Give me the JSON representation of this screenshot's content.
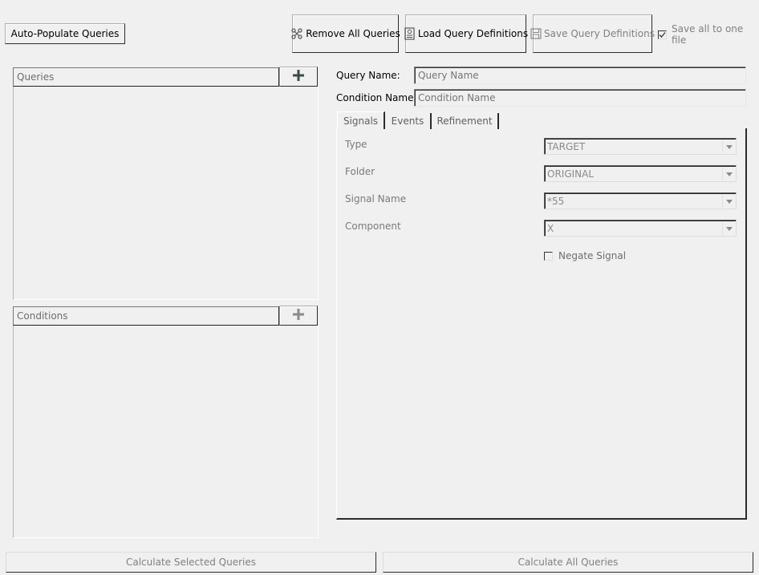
{
  "toolbar": {
    "auto_populate": "Auto-Populate Queries",
    "remove_all": "Remove All Queries",
    "load_defs": "Load Query Definitions",
    "save_defs": "Save Query Definitions",
    "save_all_one_file": "Save all to one file",
    "save_all_checked": true
  },
  "queries_panel": {
    "header": "Queries"
  },
  "conditions_panel": {
    "header": "Conditions"
  },
  "form": {
    "query_name_label": "Query Name:",
    "query_name_placeholder": "Query Name",
    "condition_name_label": "Condition Name:",
    "condition_name_placeholder": "Condition Name"
  },
  "tabs": [
    "Signals",
    "Events",
    "Refinement"
  ],
  "active_tab": "Signals",
  "signals": {
    "type_label": "Type",
    "type_value": "TARGET",
    "folder_label": "Folder",
    "folder_value": "ORIGINAL",
    "signal_name_label": "Signal Name",
    "signal_name_value": "*55",
    "component_label": "Component",
    "component_value": "X",
    "negate_label": "Negate Signal",
    "negate_checked": false
  },
  "footer": {
    "calc_selected": "Calculate Selected Queries",
    "calc_all": "Calculate All Queries"
  },
  "icons": {
    "remove_all": "remove-nodes-icon",
    "load": "load-document-icon",
    "save": "floppy-disk-icon",
    "add": "plus-icon"
  }
}
